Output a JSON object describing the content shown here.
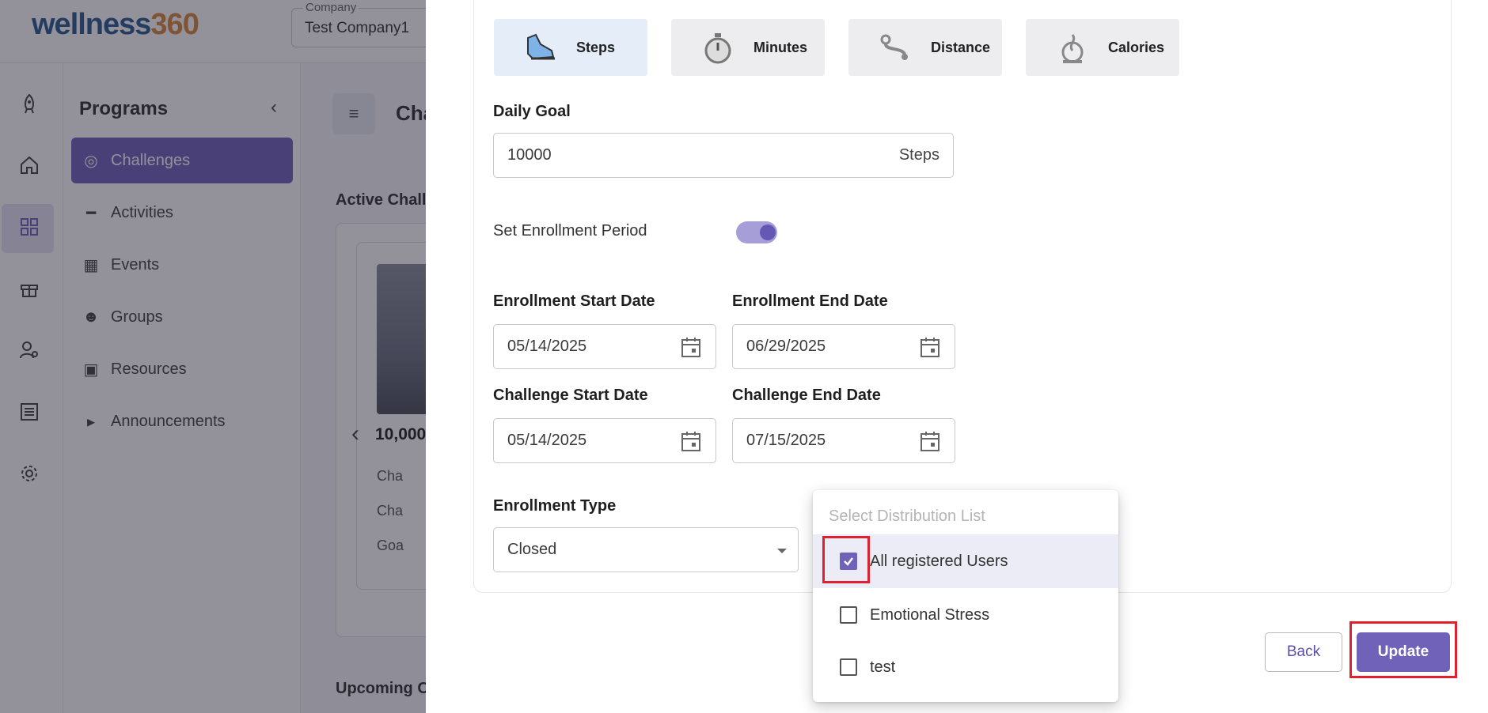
{
  "app": {
    "logo": {
      "main": "wellness",
      "accent": "360"
    },
    "company": {
      "label": "Company",
      "value": "Test Company1"
    }
  },
  "sidebar": {
    "title": "Programs",
    "items": [
      {
        "label": "Challenges",
        "icon": "target-icon",
        "active": true
      },
      {
        "label": "Activities",
        "icon": "shoe-icon"
      },
      {
        "label": "Events",
        "icon": "calendar-icon"
      },
      {
        "label": "Groups",
        "icon": "people-icon"
      },
      {
        "label": "Resources",
        "icon": "money-icon"
      },
      {
        "label": "Announcements",
        "icon": "megaphone-icon"
      }
    ]
  },
  "main": {
    "title": "Cha",
    "active_section": "Active Chall",
    "upcoming_section": "Upcoming C",
    "card": {
      "title": "10,000",
      "meta": [
        "Cha",
        "Cha",
        "Goa"
      ]
    }
  },
  "form": {
    "metrics": [
      {
        "label": "Steps",
        "active": true,
        "icon": "sneaker-icon"
      },
      {
        "label": "Minutes",
        "icon": "stopwatch-icon"
      },
      {
        "label": "Distance",
        "icon": "route-icon"
      },
      {
        "label": "Calories",
        "icon": "flame-icon"
      }
    ],
    "daily_goal": {
      "label": "Daily Goal",
      "value": "10000",
      "unit": "Steps"
    },
    "enrollment_period": {
      "label": "Set Enrollment Period",
      "enabled": true
    },
    "enrollment_start": {
      "label": "Enrollment Start Date",
      "value": "05/14/2025"
    },
    "enrollment_end": {
      "label": "Enrollment End Date",
      "value": "06/29/2025"
    },
    "challenge_start": {
      "label": "Challenge Start Date",
      "value": "05/14/2025"
    },
    "challenge_end": {
      "label": "Challenge End Date",
      "value": "07/15/2025"
    },
    "enrollment_type": {
      "label": "Enrollment Type",
      "value": "Closed"
    },
    "distribution_list": {
      "placeholder": "Select Distribution List",
      "options": [
        {
          "label": "All registered Users",
          "checked": true
        },
        {
          "label": "Emotional Stress",
          "checked": false
        },
        {
          "label": "test",
          "checked": false
        }
      ]
    },
    "buttons": {
      "back": "Back",
      "update": "Update"
    }
  },
  "colors": {
    "accent": "#6f62b8",
    "highlight": "#e0202c",
    "steps_bg": "#e5eef8"
  }
}
